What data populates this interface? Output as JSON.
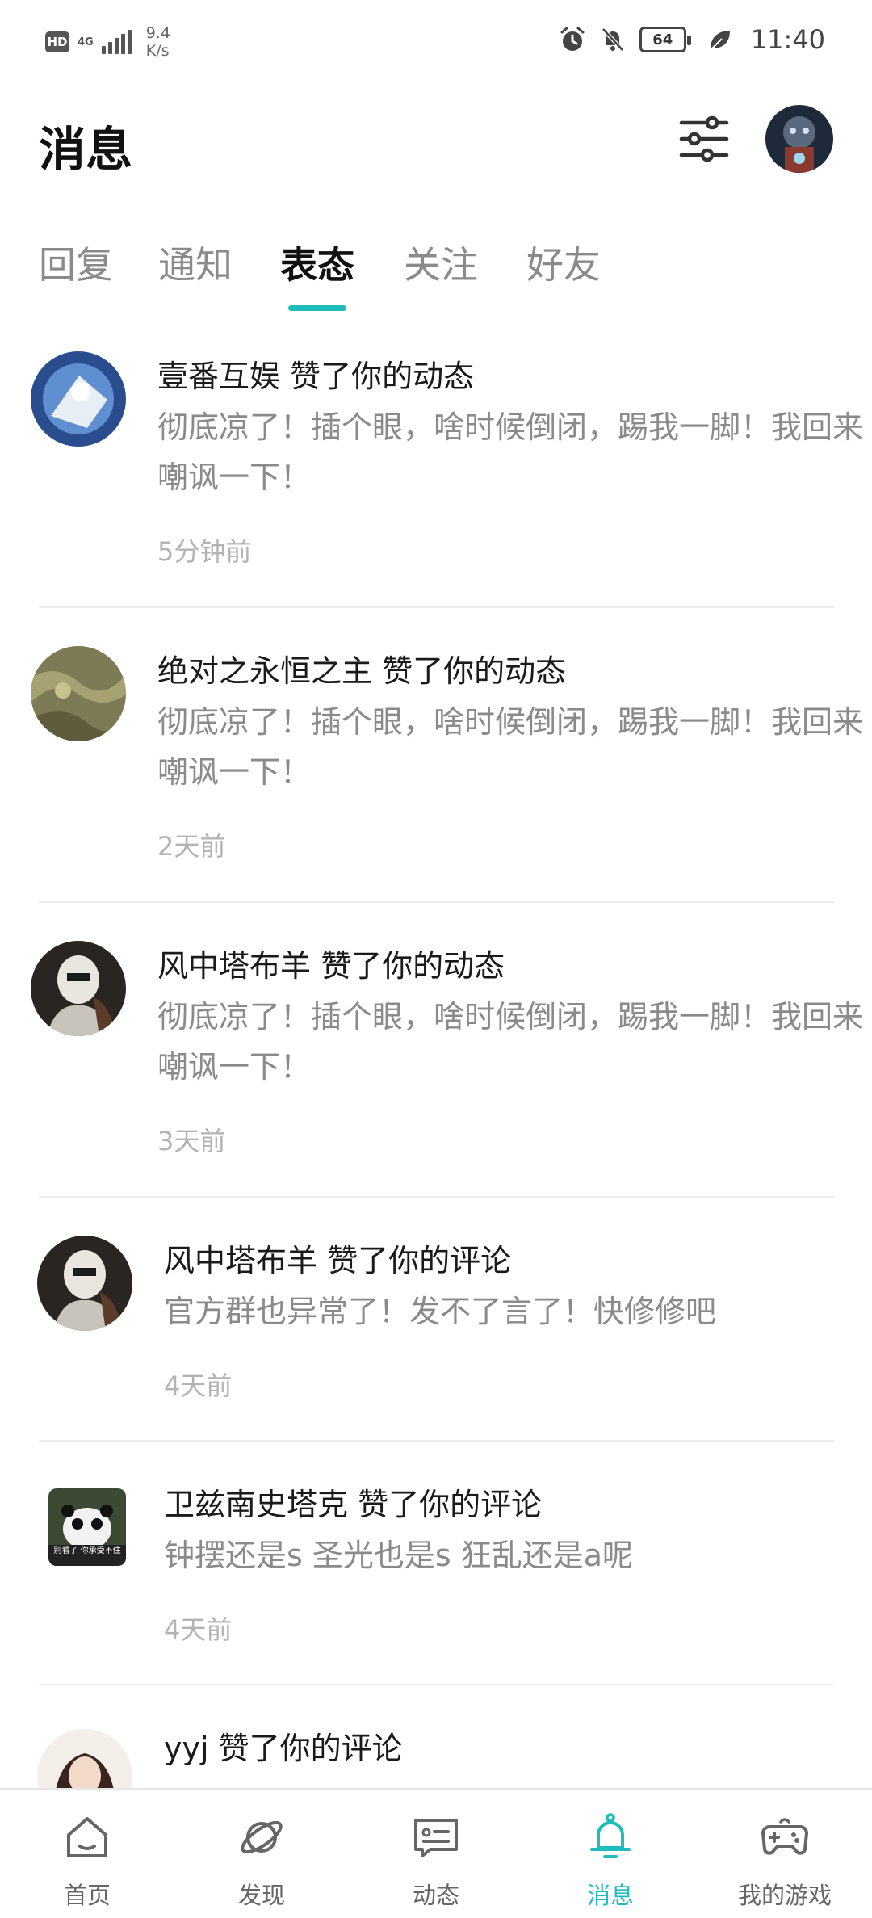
{
  "status_bar": {
    "hd": "HD",
    "network": "4G",
    "speed_value": "9.4",
    "speed_unit": "K/s",
    "battery": "64",
    "time": "11:40"
  },
  "header": {
    "title": "消息"
  },
  "tabs": [
    {
      "label": "回复",
      "active": false
    },
    {
      "label": "通知",
      "active": false
    },
    {
      "label": "表态",
      "active": true
    },
    {
      "label": "关注",
      "active": false
    },
    {
      "label": "好友",
      "active": false
    }
  ],
  "items": [
    {
      "name": "壹番互娱",
      "action": "赞了你的动态",
      "content": "彻底凉了！插个眼，啥时候倒闭，踢我一脚！我回来嘲讽一下！",
      "time": "5分钟前"
    },
    {
      "name": "绝对之永恒之主",
      "action": "赞了你的动态",
      "content": "彻底凉了！插个眼，啥时候倒闭，踢我一脚！我回来嘲讽一下！",
      "time": "2天前"
    },
    {
      "name": "风中塔布羊",
      "action": "赞了你的动态",
      "content": "彻底凉了！插个眼，啥时候倒闭，踢我一脚！我回来嘲讽一下！",
      "time": "3天前"
    },
    {
      "name": "风中塔布羊",
      "action": "赞了你的评论",
      "content": "官方群也异常了！发不了言了！快修修吧",
      "time": "4天前"
    },
    {
      "name": "卫兹南史塔克",
      "action": "赞了你的评论",
      "content": "钟摆还是s 圣光也是s 狂乱还是a呢",
      "time": "4天前",
      "avatar_caption": "别看了 你承受不住"
    },
    {
      "name": "yyj",
      "action": "赞了你的评论",
      "content": "",
      "time": ""
    }
  ],
  "bottom_nav": [
    {
      "label": "首页",
      "icon": "home-icon",
      "active": false
    },
    {
      "label": "发现",
      "icon": "planet-icon",
      "active": false
    },
    {
      "label": "动态",
      "icon": "message-card-icon",
      "active": false
    },
    {
      "label": "消息",
      "icon": "bell-icon",
      "active": true
    },
    {
      "label": "我的游戏",
      "icon": "gamepad-icon",
      "active": false
    }
  ],
  "colors": {
    "accent": "#1fbcbc",
    "text_primary": "#1a1a1a",
    "text_secondary": "#8a8a8a",
    "text_muted": "#b3b3b3"
  }
}
